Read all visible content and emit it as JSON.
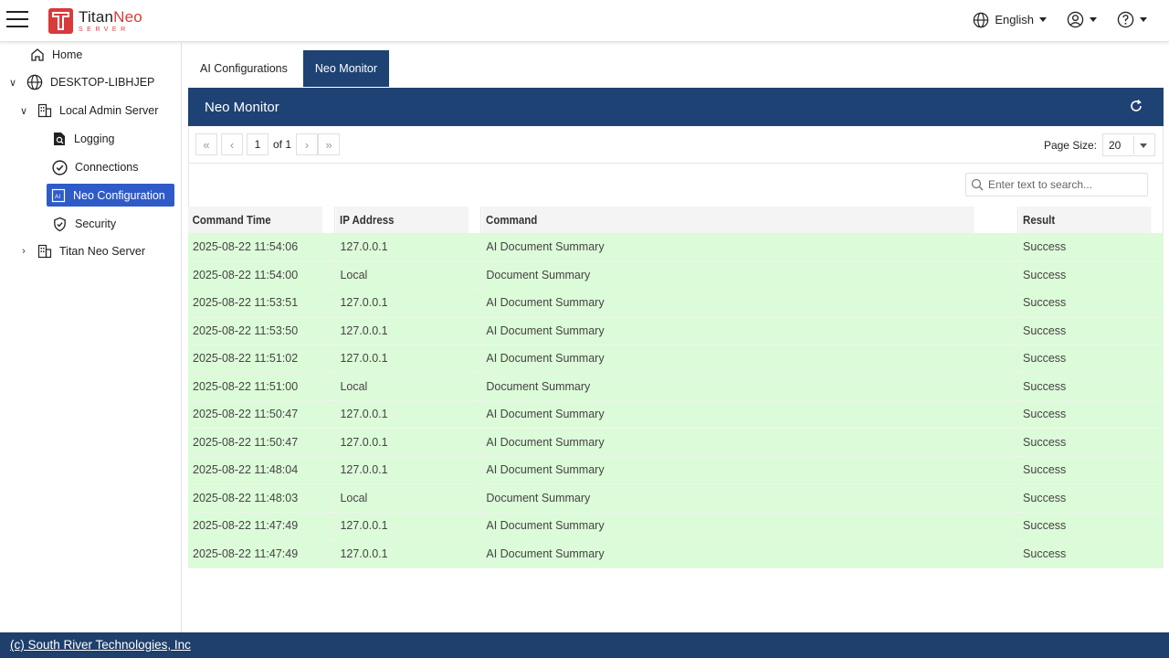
{
  "header": {
    "logo_name_1": "Titan",
    "logo_name_2": "Neo",
    "logo_sub": "SERVER",
    "language": "English"
  },
  "sidebar": {
    "home": "Home",
    "machine": "DESKTOP-LIBHJEP",
    "local_admin": "Local Admin Server",
    "logging": "Logging",
    "connections": "Connections",
    "neo_config": "Neo Configuration",
    "security": "Security",
    "titan_neo": "Titan Neo Server"
  },
  "tabs": {
    "ai_config": "AI Configurations",
    "neo_monitor": "Neo Monitor"
  },
  "panel": {
    "title": "Neo Monitor"
  },
  "pager": {
    "page": "1",
    "of": "of 1",
    "page_size_label": "Page Size:",
    "page_size": "20"
  },
  "search": {
    "placeholder": "Enter text to search..."
  },
  "table": {
    "headers": [
      "Command Time",
      "IP Address",
      "Command",
      "Result"
    ],
    "rows": [
      [
        "2025-08-22 11:54:06",
        "127.0.0.1",
        "AI Document Summary",
        "Success"
      ],
      [
        "2025-08-22 11:54:00",
        "Local",
        "Document Summary",
        "Success"
      ],
      [
        "2025-08-22 11:53:51",
        "127.0.0.1",
        "AI Document Summary",
        "Success"
      ],
      [
        "2025-08-22 11:53:50",
        "127.0.0.1",
        "AI Document Summary",
        "Success"
      ],
      [
        "2025-08-22 11:51:02",
        "127.0.0.1",
        "AI Document Summary",
        "Success"
      ],
      [
        "2025-08-22 11:51:00",
        "Local",
        "Document Summary",
        "Success"
      ],
      [
        "2025-08-22 11:50:47",
        "127.0.0.1",
        "AI Document Summary",
        "Success"
      ],
      [
        "2025-08-22 11:50:47",
        "127.0.0.1",
        "AI Document Summary",
        "Success"
      ],
      [
        "2025-08-22 11:48:04",
        "127.0.0.1",
        "AI Document Summary",
        "Success"
      ],
      [
        "2025-08-22 11:48:03",
        "Local",
        "Document Summary",
        "Success"
      ],
      [
        "2025-08-22 11:47:49",
        "127.0.0.1",
        "AI Document Summary",
        "Success"
      ],
      [
        "2025-08-22 11:47:49",
        "127.0.0.1",
        "AI Document Summary",
        "Success"
      ]
    ]
  },
  "footer": {
    "link": "(c) South River Technologies, Inc"
  },
  "colors": {
    "header_blue": "#1f4274",
    "active_nav": "#2f5bc9",
    "row_green": "#dcfbd8",
    "brand_red": "#d93a3a"
  }
}
